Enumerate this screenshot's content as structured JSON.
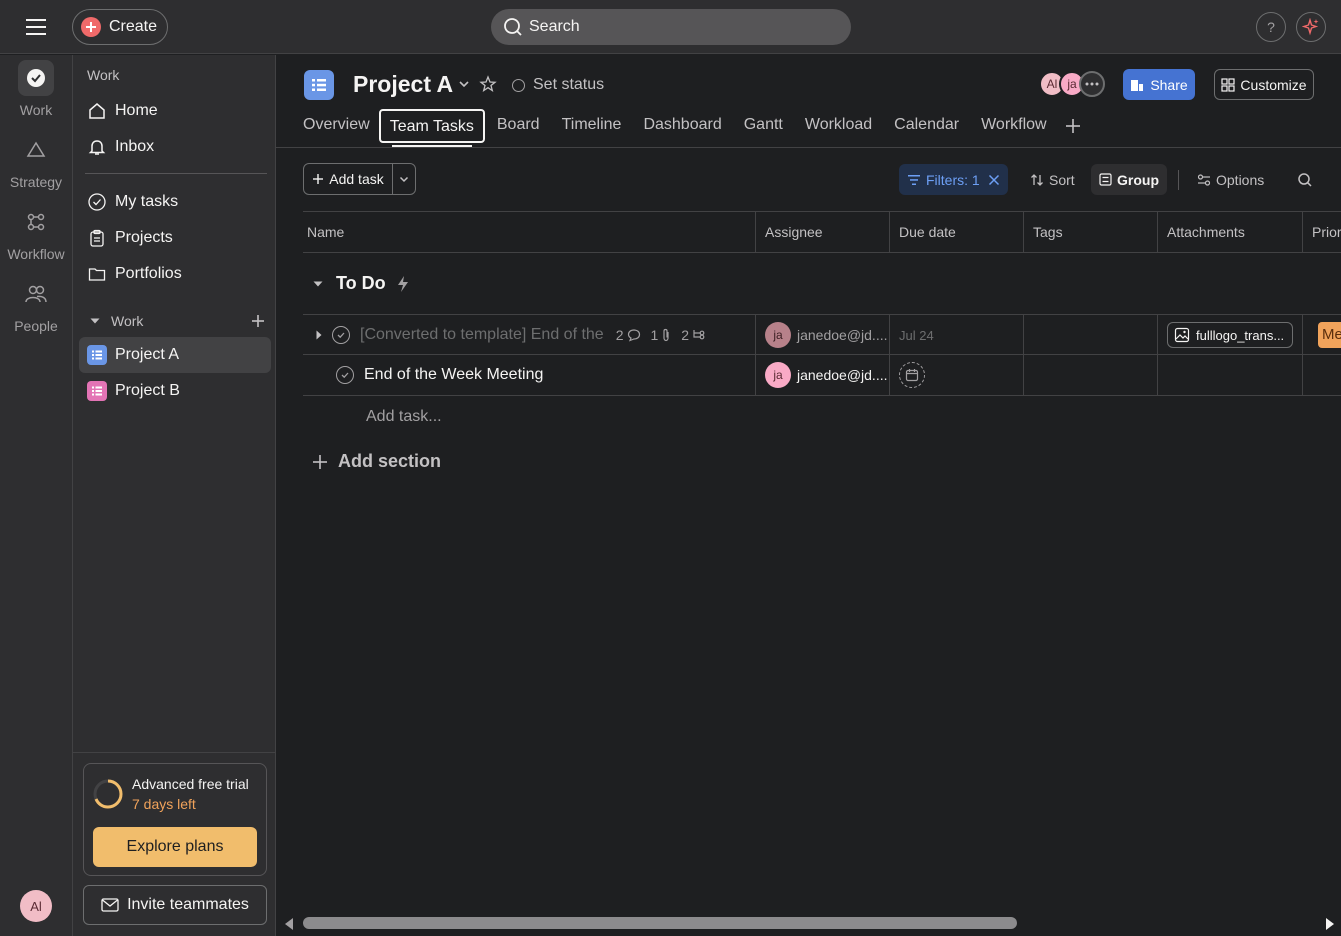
{
  "topbar": {
    "create_label": "Create",
    "search_placeholder": "Search",
    "help_label": "?"
  },
  "rail": {
    "items": [
      {
        "label": "Work",
        "icon": "check-circle-icon"
      },
      {
        "label": "Strategy",
        "icon": "triangle-icon"
      },
      {
        "label": "Workflow",
        "icon": "workflow-icon"
      },
      {
        "label": "People",
        "icon": "people-icon"
      }
    ],
    "user_initials": "Al"
  },
  "sidebar": {
    "heading": "Work",
    "primary": [
      {
        "label": "Home",
        "icon": "home-icon"
      },
      {
        "label": "Inbox",
        "icon": "bell-icon"
      }
    ],
    "secondary": [
      {
        "label": "My tasks",
        "icon": "check-circle-icon"
      },
      {
        "label": "Projects",
        "icon": "clipboard-icon"
      },
      {
        "label": "Portfolios",
        "icon": "folder-icon"
      }
    ],
    "section_label": "Work",
    "projects": [
      {
        "label": "Project A",
        "color": "#6a96e6",
        "active": true
      },
      {
        "label": "Project B",
        "color": "#e374b5",
        "active": false
      }
    ],
    "trial": {
      "title": "Advanced free trial",
      "days_left": "7 days left",
      "cta": "Explore plans"
    },
    "invite_label": "Invite teammates"
  },
  "project": {
    "title": "Project A",
    "set_status": "Set status",
    "members": [
      {
        "initials": "Al",
        "color": "#f1bdc6"
      },
      {
        "initials": "ja",
        "color": "#f9aac6"
      }
    ],
    "share_label": "Share",
    "customize_label": "Customize",
    "tabs": [
      "Overview",
      "Team Tasks",
      "Board",
      "Timeline",
      "Dashboard",
      "Gantt",
      "Workload",
      "Calendar",
      "Workflow"
    ],
    "active_tab": "Team Tasks"
  },
  "toolbar": {
    "add_task": "Add task",
    "filters": "Filters: 1",
    "sort": "Sort",
    "group": "Group",
    "options": "Options"
  },
  "table": {
    "columns": [
      "Name",
      "Assignee",
      "Due date",
      "Tags",
      "Attachments",
      "Prior"
    ],
    "section": "To Do",
    "rows": [
      {
        "name": "[Converted to template] End of the",
        "comments": "2",
        "attachments_count": "1",
        "subtasks": "2",
        "assignee_initials": "ja",
        "assignee": "janedoe@jd....",
        "due": "Jul 24",
        "attachment_name": "fulllogo_trans...",
        "priority": "Me",
        "dim": true
      },
      {
        "name": "End of the Week Meeting",
        "assignee_initials": "ja",
        "assignee": "janedoe@jd....",
        "due": "",
        "dim": false
      }
    ],
    "add_task_placeholder": "Add task...",
    "add_section": "Add section"
  },
  "colors": {
    "accent_blue": "#4573d2",
    "brand_coral": "#f06a6a",
    "trial_yellow": "#f1bd6c",
    "priority_orange": "#f1a35b"
  }
}
